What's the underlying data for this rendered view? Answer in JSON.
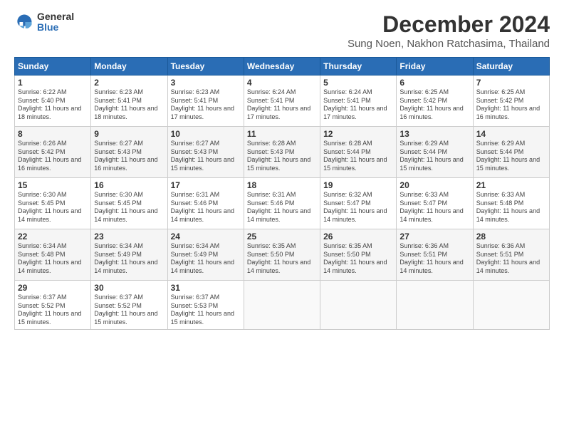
{
  "logo": {
    "general": "General",
    "blue": "Blue"
  },
  "title": "December 2024",
  "location": "Sung Noen, Nakhon Ratchasima, Thailand",
  "days_header": [
    "Sunday",
    "Monday",
    "Tuesday",
    "Wednesday",
    "Thursday",
    "Friday",
    "Saturday"
  ],
  "weeks": [
    [
      {
        "day": "1",
        "sunrise": "6:22 AM",
        "sunset": "5:40 PM",
        "daylight": "11 hours and 18 minutes."
      },
      {
        "day": "2",
        "sunrise": "6:23 AM",
        "sunset": "5:41 PM",
        "daylight": "11 hours and 18 minutes."
      },
      {
        "day": "3",
        "sunrise": "6:23 AM",
        "sunset": "5:41 PM",
        "daylight": "11 hours and 17 minutes."
      },
      {
        "day": "4",
        "sunrise": "6:24 AM",
        "sunset": "5:41 PM",
        "daylight": "11 hours and 17 minutes."
      },
      {
        "day": "5",
        "sunrise": "6:24 AM",
        "sunset": "5:41 PM",
        "daylight": "11 hours and 17 minutes."
      },
      {
        "day": "6",
        "sunrise": "6:25 AM",
        "sunset": "5:42 PM",
        "daylight": "11 hours and 16 minutes."
      },
      {
        "day": "7",
        "sunrise": "6:25 AM",
        "sunset": "5:42 PM",
        "daylight": "11 hours and 16 minutes."
      }
    ],
    [
      {
        "day": "8",
        "sunrise": "6:26 AM",
        "sunset": "5:42 PM",
        "daylight": "11 hours and 16 minutes."
      },
      {
        "day": "9",
        "sunrise": "6:27 AM",
        "sunset": "5:43 PM",
        "daylight": "11 hours and 16 minutes."
      },
      {
        "day": "10",
        "sunrise": "6:27 AM",
        "sunset": "5:43 PM",
        "daylight": "11 hours and 15 minutes."
      },
      {
        "day": "11",
        "sunrise": "6:28 AM",
        "sunset": "5:43 PM",
        "daylight": "11 hours and 15 minutes."
      },
      {
        "day": "12",
        "sunrise": "6:28 AM",
        "sunset": "5:44 PM",
        "daylight": "11 hours and 15 minutes."
      },
      {
        "day": "13",
        "sunrise": "6:29 AM",
        "sunset": "5:44 PM",
        "daylight": "11 hours and 15 minutes."
      },
      {
        "day": "14",
        "sunrise": "6:29 AM",
        "sunset": "5:44 PM",
        "daylight": "11 hours and 15 minutes."
      }
    ],
    [
      {
        "day": "15",
        "sunrise": "6:30 AM",
        "sunset": "5:45 PM",
        "daylight": "11 hours and 14 minutes."
      },
      {
        "day": "16",
        "sunrise": "6:30 AM",
        "sunset": "5:45 PM",
        "daylight": "11 hours and 14 minutes."
      },
      {
        "day": "17",
        "sunrise": "6:31 AM",
        "sunset": "5:46 PM",
        "daylight": "11 hours and 14 minutes."
      },
      {
        "day": "18",
        "sunrise": "6:31 AM",
        "sunset": "5:46 PM",
        "daylight": "11 hours and 14 minutes."
      },
      {
        "day": "19",
        "sunrise": "6:32 AM",
        "sunset": "5:47 PM",
        "daylight": "11 hours and 14 minutes."
      },
      {
        "day": "20",
        "sunrise": "6:33 AM",
        "sunset": "5:47 PM",
        "daylight": "11 hours and 14 minutes."
      },
      {
        "day": "21",
        "sunrise": "6:33 AM",
        "sunset": "5:48 PM",
        "daylight": "11 hours and 14 minutes."
      }
    ],
    [
      {
        "day": "22",
        "sunrise": "6:34 AM",
        "sunset": "5:48 PM",
        "daylight": "11 hours and 14 minutes."
      },
      {
        "day": "23",
        "sunrise": "6:34 AM",
        "sunset": "5:49 PM",
        "daylight": "11 hours and 14 minutes."
      },
      {
        "day": "24",
        "sunrise": "6:34 AM",
        "sunset": "5:49 PM",
        "daylight": "11 hours and 14 minutes."
      },
      {
        "day": "25",
        "sunrise": "6:35 AM",
        "sunset": "5:50 PM",
        "daylight": "11 hours and 14 minutes."
      },
      {
        "day": "26",
        "sunrise": "6:35 AM",
        "sunset": "5:50 PM",
        "daylight": "11 hours and 14 minutes."
      },
      {
        "day": "27",
        "sunrise": "6:36 AM",
        "sunset": "5:51 PM",
        "daylight": "11 hours and 14 minutes."
      },
      {
        "day": "28",
        "sunrise": "6:36 AM",
        "sunset": "5:51 PM",
        "daylight": "11 hours and 14 minutes."
      }
    ],
    [
      {
        "day": "29",
        "sunrise": "6:37 AM",
        "sunset": "5:52 PM",
        "daylight": "11 hours and 15 minutes."
      },
      {
        "day": "30",
        "sunrise": "6:37 AM",
        "sunset": "5:52 PM",
        "daylight": "11 hours and 15 minutes."
      },
      {
        "day": "31",
        "sunrise": "6:37 AM",
        "sunset": "5:53 PM",
        "daylight": "11 hours and 15 minutes."
      },
      null,
      null,
      null,
      null
    ]
  ]
}
